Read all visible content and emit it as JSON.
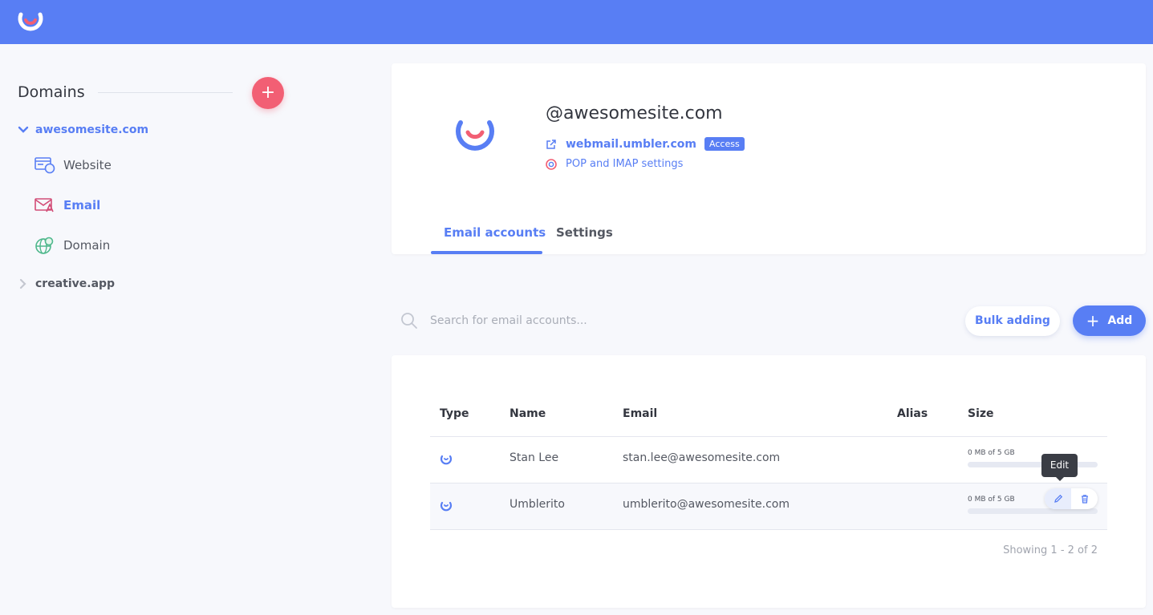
{
  "app": {
    "name": "Umbler",
    "brand_color": "#587ef4",
    "accent_color": "#f25f74",
    "logo_icon": "umbler-logo-icon"
  },
  "sidebar": {
    "title": "Domains",
    "add_button": "+",
    "domains": [
      {
        "name": "awesomesite.com",
        "expanded": true,
        "items": [
          {
            "label": "Website",
            "icon": "website-icon"
          },
          {
            "label": "Email",
            "icon": "email-icon",
            "active": true
          },
          {
            "label": "Domain",
            "icon": "globe-icon"
          }
        ]
      },
      {
        "name": "creative.app",
        "expanded": false
      }
    ]
  },
  "header": {
    "domain": "@awesomesite.com",
    "webmail_link": "webmail.umbler.com",
    "access_badge": "Access",
    "pop_imap_link": "POP and IMAP settings",
    "tabs": [
      {
        "label": "Email accounts",
        "active": true
      },
      {
        "label": "Settings"
      }
    ]
  },
  "toolbar": {
    "search_placeholder": "Search for email accounts...",
    "bulk_label": "Bulk adding",
    "add_label": "Add"
  },
  "table": {
    "columns": [
      "Type",
      "Name",
      "Email",
      "Alias",
      "Size"
    ],
    "rows": [
      {
        "name": "Stan Lee",
        "email": "stan.lee@awesomesite.com",
        "alias": "",
        "size": "0 MB of 5 GB",
        "usage": 0
      },
      {
        "name": "Umblerito",
        "email": "umblerito@awesomesite.com",
        "alias": "",
        "size": "0 MB of 5 GB",
        "usage": 0
      }
    ],
    "tooltip": "Edit",
    "showing": "Showing 1 - 2 of 2"
  }
}
